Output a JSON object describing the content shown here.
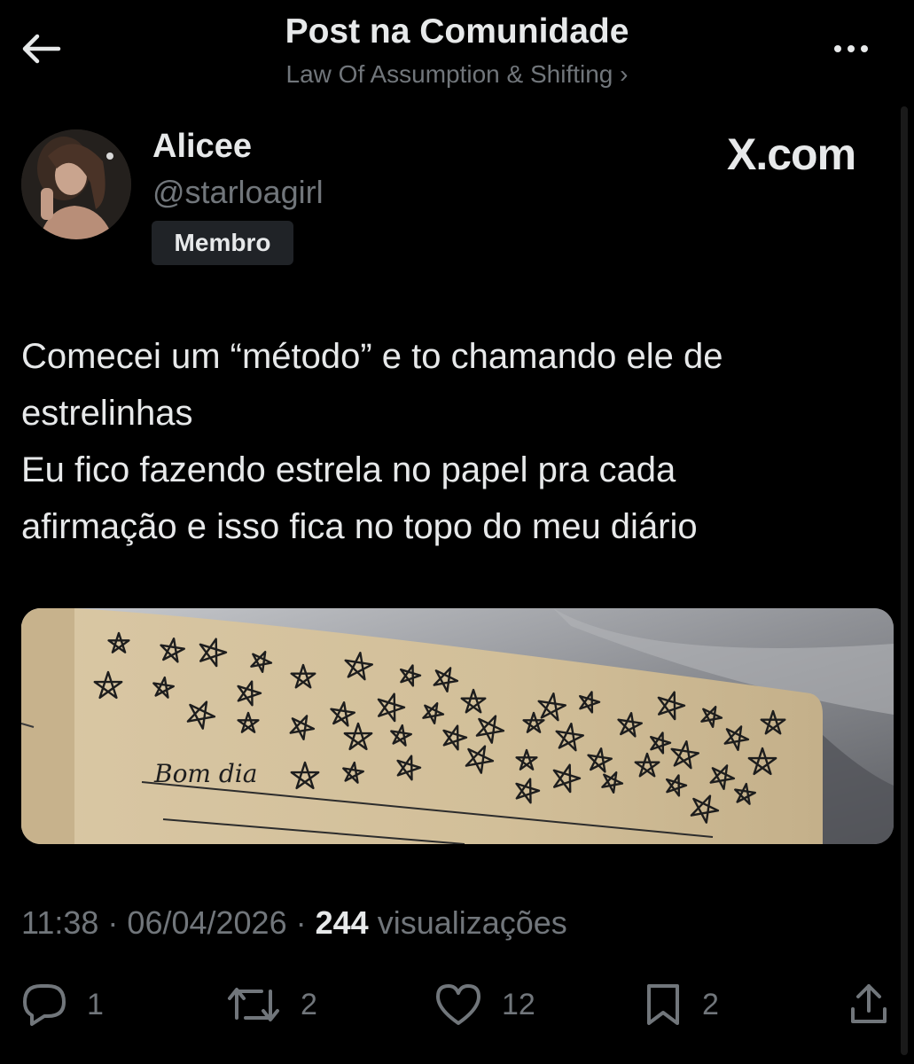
{
  "header": {
    "title": "Post na Comunidade",
    "subtitle": "Law Of Assumption & Shifting ›"
  },
  "author": {
    "name": "Alicee",
    "handle": "@starloagirl",
    "badge": "Membro"
  },
  "brand": "X.com",
  "post": {
    "text": "Comecei um “método” e to chamando ele de\nestrelinhas\nEu fico fazendo estrela no papel pra cada\nafirmação e isso fica no topo do meu diário"
  },
  "media_caption": "Bom dia",
  "meta": {
    "time": "11:38",
    "sep1": " · ",
    "date": "06/04/2026",
    "sep2": " · ",
    "views_count": "244",
    "views_label": "visualizações"
  },
  "actions": {
    "replies": "1",
    "reposts": "2",
    "likes": "12",
    "bookmarks": "2"
  },
  "icons": {
    "back": "back-arrow-icon",
    "more": "more-icon",
    "reply": "reply-icon",
    "repost": "repost-icon",
    "like": "like-icon",
    "bookmark": "bookmark-icon",
    "share": "share-icon"
  }
}
